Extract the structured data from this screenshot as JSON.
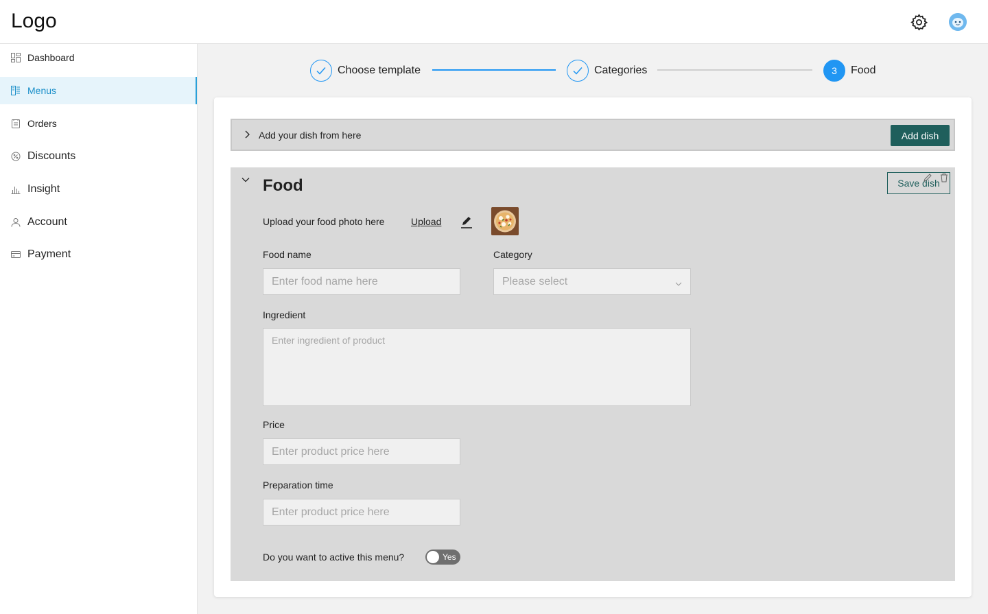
{
  "header": {
    "logo": "Logo",
    "settings_icon": "gear-icon",
    "avatar_icon": "user-avatar"
  },
  "sidebar": {
    "items": [
      {
        "label": "Dashboard",
        "icon": "dashboard-icon",
        "active": false
      },
      {
        "label": "Menus",
        "icon": "menu-book-icon",
        "active": true
      },
      {
        "label": "Orders",
        "icon": "orders-icon",
        "active": false
      },
      {
        "label": "Discounts",
        "icon": "discount-icon",
        "active": false
      },
      {
        "label": "Insight",
        "icon": "chart-icon",
        "active": false
      },
      {
        "label": "Account",
        "icon": "user-icon",
        "active": false
      },
      {
        "label": "Payment",
        "icon": "card-icon",
        "active": false
      }
    ]
  },
  "stepper": {
    "steps": [
      {
        "label": "Choose template",
        "state": "done"
      },
      {
        "label": "Categories",
        "state": "done"
      },
      {
        "label": "Food",
        "state": "current",
        "number": "3"
      }
    ],
    "accent": "#2196f3"
  },
  "add_bar": {
    "text": "Add your dish from here",
    "button": "Add dish"
  },
  "food_panel": {
    "title": "Food",
    "save_button": "Save dish",
    "upload": {
      "label": "Upload your food photo here",
      "link": "Upload"
    },
    "food_name": {
      "label": "Food name",
      "placeholder": "Enter food name here"
    },
    "category": {
      "label": "Category",
      "placeholder": "Please select"
    },
    "ingredient": {
      "label": "Ingredient",
      "placeholder": "Enter ingredient of product"
    },
    "price": {
      "label": "Price",
      "placeholder": "Enter product price here"
    },
    "prep_time": {
      "label": "Preparation time",
      "placeholder": "Enter product price here"
    },
    "active_question": "Do you want to active this menu?",
    "toggle_label": "Yes"
  },
  "colors": {
    "primary_dark": "#1f5f5c",
    "active_nav_bg": "#e6f4fb",
    "active_nav_text": "#1b8fc9"
  }
}
